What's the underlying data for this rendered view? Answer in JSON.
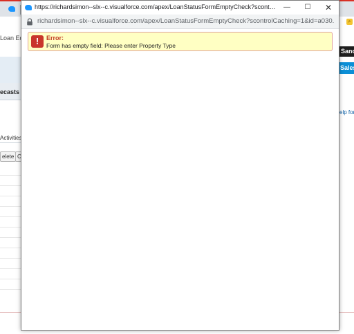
{
  "background": {
    "left_title": "Loan Edi",
    "nav_label": "ecasts",
    "activities_label": "Activities",
    "buttons": [
      "elete",
      "C"
    ],
    "sandbox_label": "Sand",
    "sales_label": "Sales",
    "help_link": "elp for"
  },
  "popup": {
    "title": "https://richardsimon--slx--c.visualforce.com/apex/LoanStatusFormEmptyCheck?scontrolCaching=...",
    "url": "richardsimon--slx--c.visualforce.com/apex/LoanStatusFormEmptyCheck?scontrolCaching=1&id=a030...",
    "error": {
      "title": "Error:",
      "message": "Form has empty field: Please enter Property Type"
    },
    "controls": {
      "minimize": "—",
      "maximize": "☐",
      "close": "✕"
    }
  },
  "colors": {
    "error_background": "#ffffc3",
    "error_border": "#e0a29b",
    "error_icon": "#c9362b",
    "error_title": "#c23b22",
    "salesforce_blue": "#1b96ff"
  }
}
